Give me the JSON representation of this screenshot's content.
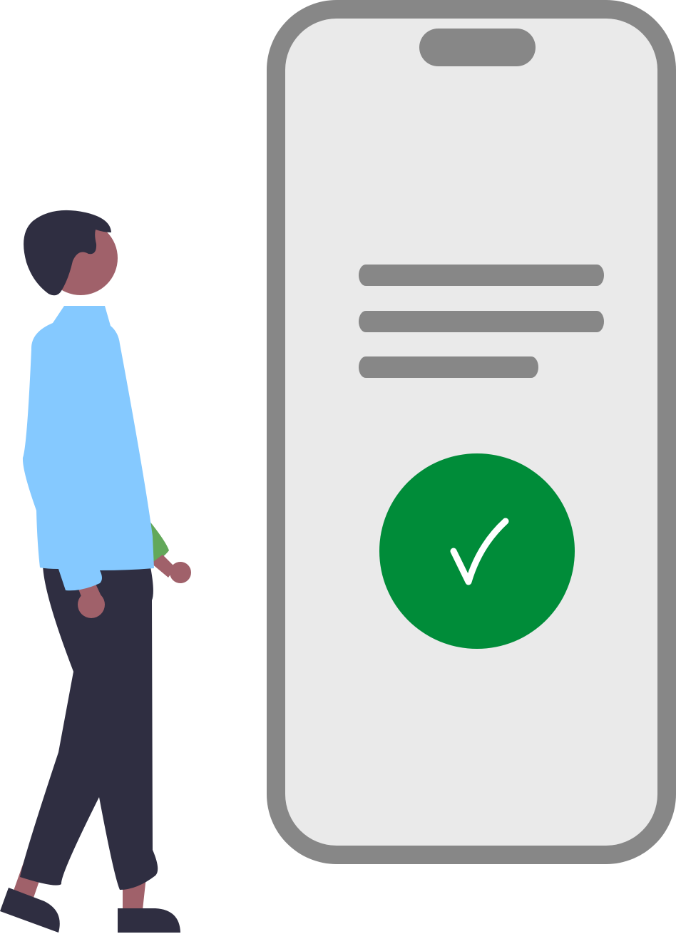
{
  "illustration": {
    "subject": "",
    "colors": {
      "phone_frame": "#878787",
      "phone_screen": "#eaeaea",
      "notch": "#878787",
      "text_line": "#878787",
      "check_circle": "#008c39",
      "check_mark": "#ffffff",
      "skin": "#a0616a",
      "hair": "#2f2e41",
      "shirt": "#85c9ff",
      "pants": "#2f2e41",
      "shoes": "#2f2e41",
      "held_item": "#62a85a"
    },
    "icons": {
      "success": "checkmark-icon"
    }
  }
}
